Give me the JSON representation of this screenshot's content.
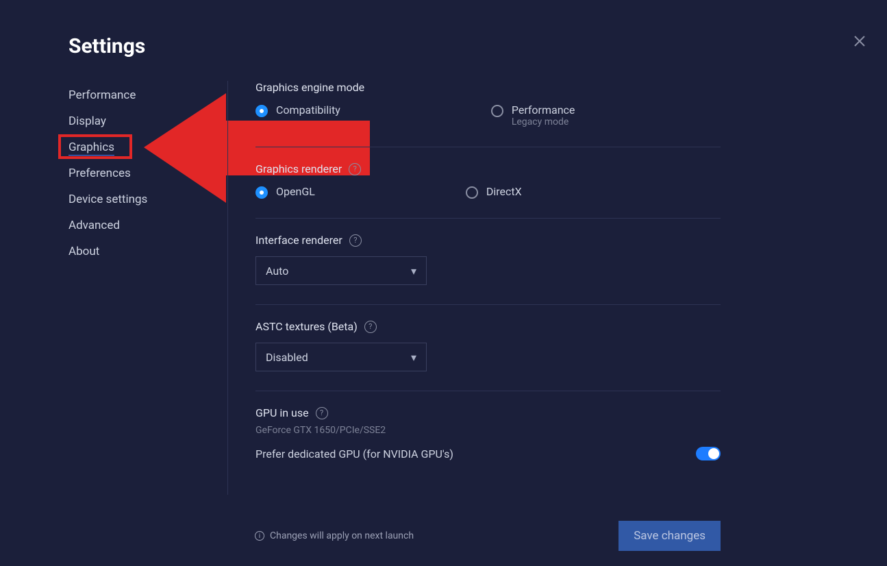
{
  "header": {
    "title": "Settings"
  },
  "sidebar": {
    "items": [
      {
        "label": "Performance",
        "active": false
      },
      {
        "label": "Display",
        "active": false
      },
      {
        "label": "Graphics",
        "active": true
      },
      {
        "label": "Preferences",
        "active": false
      },
      {
        "label": "Device settings",
        "active": false
      },
      {
        "label": "Advanced",
        "active": false
      },
      {
        "label": "About",
        "active": false
      }
    ]
  },
  "main": {
    "engine_mode": {
      "title": "Graphics engine mode",
      "option_a": {
        "label": "Compatibility"
      },
      "option_b": {
        "label": "Performance",
        "sublabel": "Legacy mode"
      },
      "selected": "Compatibility"
    },
    "graphics_renderer": {
      "title": "Graphics renderer",
      "option_a": {
        "label": "OpenGL"
      },
      "option_b": {
        "label": "DirectX"
      },
      "selected": "OpenGL"
    },
    "interface_renderer": {
      "title": "Interface renderer",
      "value": "Auto"
    },
    "astc": {
      "title": "ASTC textures (Beta)",
      "value": "Disabled"
    },
    "gpu": {
      "title": "GPU in use",
      "value": "GeForce GTX 1650/PCIe/SSE2",
      "toggle_label": "Prefer dedicated GPU (for NVIDIA GPU's)",
      "toggle_on": true
    }
  },
  "footer": {
    "notice": "Changes will apply on next launch",
    "save_label": "Save changes"
  },
  "annotation": {
    "type": "arrow-pointer",
    "target": "sidebar-item-graphics",
    "color": "#e22727"
  }
}
